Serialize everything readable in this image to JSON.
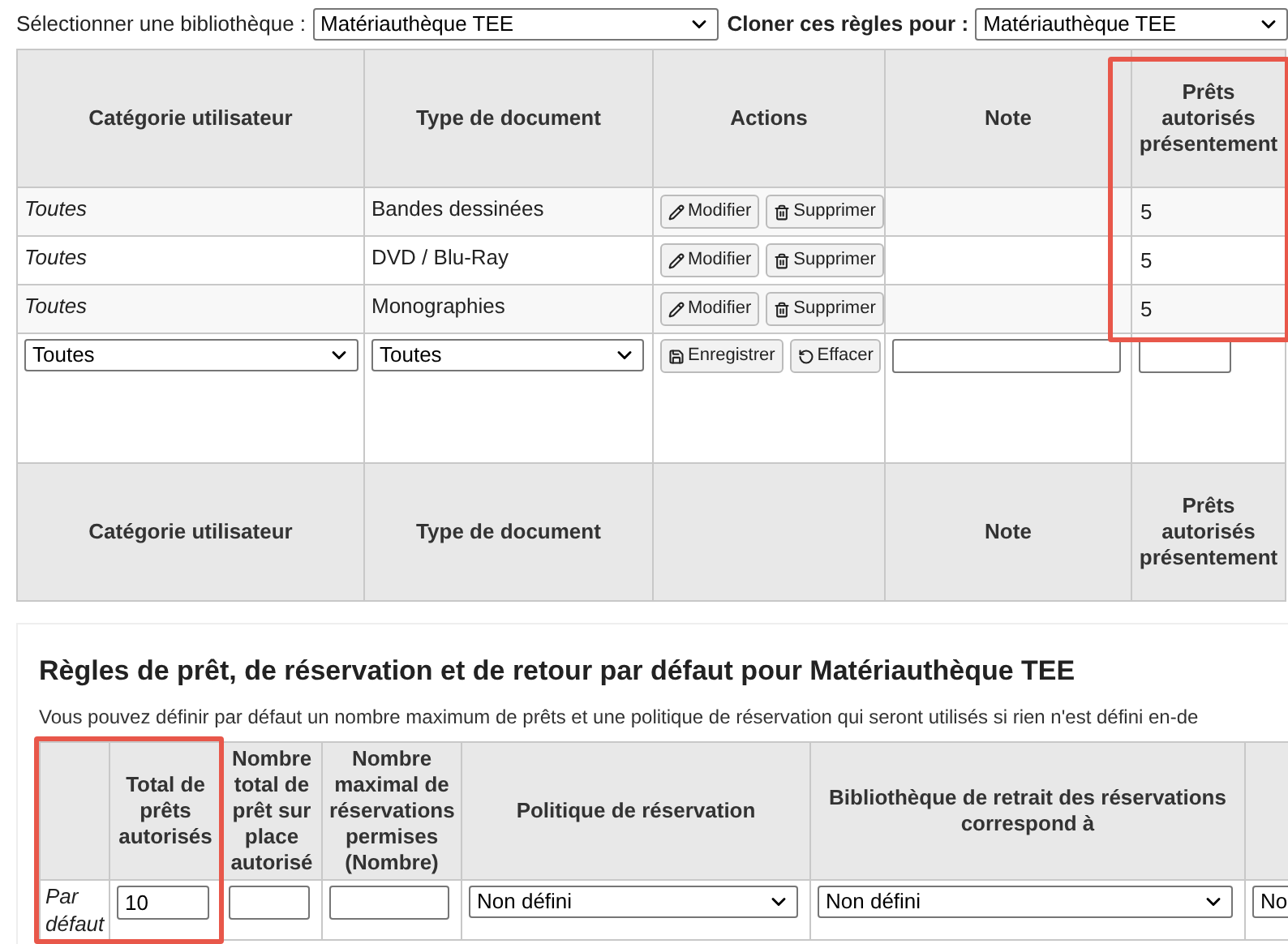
{
  "library_selector": {
    "label": "Sélectionner une bibliothèque :",
    "value": "Matériauthèque TEE"
  },
  "clone": {
    "label": "Cloner ces règles pour :",
    "value": "Matériauthèque TEE"
  },
  "rules_table": {
    "columns": [
      "Catégorie utilisateur",
      "Type de document",
      "Actions",
      "Note",
      "Prêts autorisés présentement"
    ],
    "rows": [
      {
        "category": "Toutes",
        "document_type": "Bandes dessinées",
        "buttons": [
          {
            "kind": "edit",
            "label": "Modifier"
          },
          {
            "kind": "delete",
            "label": "Supprimer"
          }
        ],
        "loans": "5"
      },
      {
        "category": "Toutes",
        "document_type": "DVD / Blu-Ray",
        "buttons": [
          {
            "kind": "edit",
            "label": "Modifier"
          },
          {
            "kind": "delete",
            "label": "Supprimer"
          }
        ],
        "loans": "5"
      },
      {
        "category": "Toutes",
        "document_type": "Monographies",
        "buttons": [
          {
            "kind": "edit",
            "label": "Modifier"
          },
          {
            "kind": "delete",
            "label": "Supprimer"
          }
        ],
        "loans": "5"
      }
    ],
    "new_row": {
      "category": "Toutes",
      "document_type": "Toutes",
      "buttons": [
        {
          "kind": "save",
          "label": "Enregistrer"
        },
        {
          "kind": "clear",
          "label": "Effacer"
        }
      ]
    },
    "footer_columns": [
      {
        "kind": "text",
        "label": "Catégorie utilisateur"
      },
      {
        "kind": "text",
        "label": "Type de document"
      },
      {
        "kind": "blank"
      },
      {
        "kind": "text",
        "label": "Note"
      },
      {
        "kind": "text",
        "label": "Prêts autorisés présentement"
      }
    ]
  },
  "defaults": {
    "title": "Règles de prêt, de réservation et de retour par défaut pour Matériauthèque TEE",
    "description": "Vous pouvez définir par défaut un nombre maximum de prêts et une politique de réservation qui seront utilisés si rien n'est défini en-de",
    "columns": [
      {
        "kind": "blank"
      },
      {
        "kind": "text",
        "label": "Total de prêts autorisés"
      },
      {
        "kind": "text",
        "label": "Nombre total de prêt sur place autorisé"
      },
      {
        "kind": "text",
        "label": "Nombre maximal de réservations permises (Nombre)"
      },
      {
        "kind": "text",
        "label": "Politique de réservation"
      },
      {
        "kind": "text",
        "label": "Bibliothèque de retrait des réservations correspond à"
      },
      {
        "kind": "blank"
      }
    ],
    "row": {
      "label": "Par défaut",
      "cells": [
        {
          "kind": "input",
          "value": "10"
        },
        {
          "kind": "input"
        },
        {
          "kind": "input"
        },
        {
          "kind": "select",
          "value": "Non défini"
        },
        {
          "kind": "select",
          "value": "Non défini"
        },
        {
          "kind": "select",
          "value": "No"
        }
      ]
    }
  }
}
